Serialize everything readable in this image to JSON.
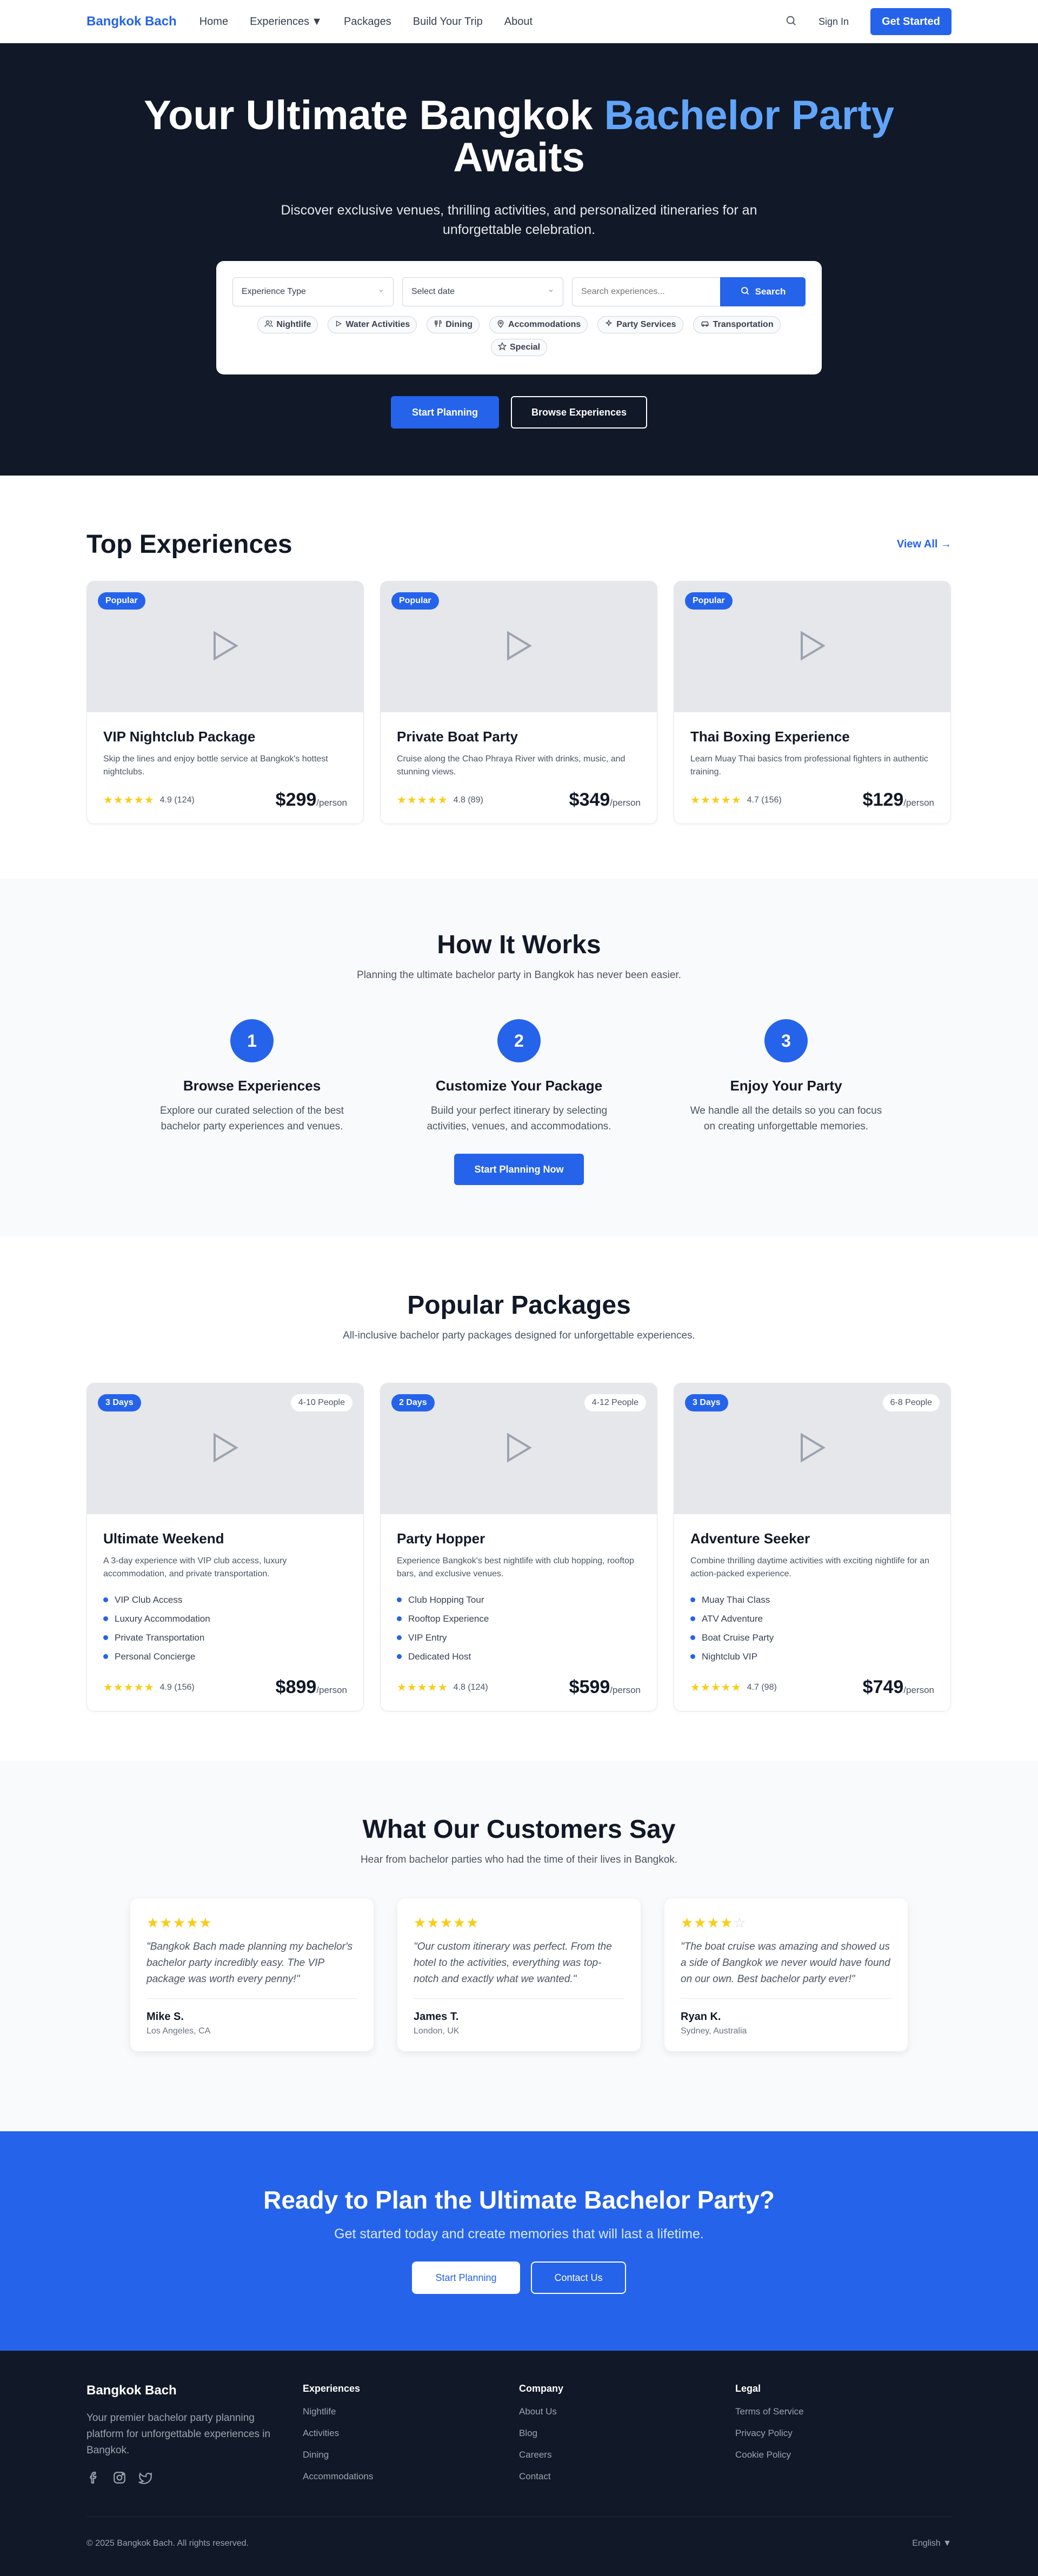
{
  "nav": {
    "brand": "Bangkok Bach",
    "links": [
      "Home",
      "Experiences",
      "Packages",
      "Build Your Trip",
      "About"
    ],
    "signin": "Sign In",
    "cta": "Get Started"
  },
  "hero": {
    "title_main": "Your Ultimate Bangkok ",
    "title_accent": "Bachelor Party",
    "title_end": "Awaits",
    "subtitle": "Discover exclusive venues, thrilling activities, and personalized itineraries for an unforgettable celebration.",
    "select_type": "Experience Type",
    "select_date": "Select date",
    "search_placeholder": "Search experiences...",
    "search_button": "Search",
    "chips": [
      "Nightlife",
      "Water Activities",
      "Dining",
      "Accommodations",
      "Party Services",
      "Transportation",
      "Special"
    ],
    "btn_primary": "Start Planning",
    "btn_secondary": "Browse Experiences"
  },
  "top": {
    "title": "Top Experiences",
    "view_all": "View All →",
    "cards": [
      {
        "badge": "Popular",
        "title": "VIP Nightclub Package",
        "desc": "Skip the lines and enjoy bottle service at Bangkok's hottest nightclubs.",
        "rating": "4.9 (124)",
        "stars": 5,
        "price": "$299",
        "per": "/person"
      },
      {
        "badge": "Popular",
        "title": "Private Boat Party",
        "desc": "Cruise along the Chao Phraya River with drinks, music, and stunning views.",
        "rating": "4.8 (89)",
        "stars": 5,
        "price": "$349",
        "per": "/person"
      },
      {
        "badge": "Popular",
        "title": "Thai Boxing Experience",
        "desc": "Learn Muay Thai basics from professional fighters in authentic training.",
        "rating": "4.7 (156)",
        "stars": 5,
        "price": "$129",
        "per": "/person"
      }
    ]
  },
  "how": {
    "title": "How It Works",
    "subtitle": "Planning the ultimate bachelor party in Bangkok has never been easier.",
    "steps": [
      {
        "num": "1",
        "title": "Browse Experiences",
        "desc": "Explore our curated selection of the best bachelor party experiences and venues."
      },
      {
        "num": "2",
        "title": "Customize Your Package",
        "desc": "Build your perfect itinerary by selecting activities, venues, and accommodations."
      },
      {
        "num": "3",
        "title": "Enjoy Your Party",
        "desc": "We handle all the details so you can focus on creating unforgettable memories."
      }
    ],
    "cta": "Start Planning Now"
  },
  "packages": {
    "title": "Popular Packages",
    "subtitle": "All-inclusive bachelor party packages designed for unforgettable experiences.",
    "cards": [
      {
        "days": "3 Days",
        "people": "4-10 People",
        "title": "Ultimate Weekend",
        "desc": "A 3-day experience with VIP club access, luxury accommodation, and private transportation.",
        "features": [
          "VIP Club Access",
          "Luxury Accommodation",
          "Private Transportation",
          "Personal Concierge"
        ],
        "rating": "4.9 (156)",
        "price": "$899",
        "per": "/person"
      },
      {
        "days": "2 Days",
        "people": "4-12 People",
        "title": "Party Hopper",
        "desc": "Experience Bangkok's best nightlife with club hopping, rooftop bars, and exclusive venues.",
        "features": [
          "Club Hopping Tour",
          "Rooftop Experience",
          "VIP Entry",
          "Dedicated Host"
        ],
        "rating": "4.8 (124)",
        "price": "$599",
        "per": "/person"
      },
      {
        "days": "3 Days",
        "people": "6-8 People",
        "title": "Adventure Seeker",
        "desc": "Combine thrilling daytime activities with exciting nightlife for an action-packed experience.",
        "features": [
          "Muay Thai Class",
          "ATV Adventure",
          "Boat Cruise Party",
          "Nightclub VIP"
        ],
        "rating": "4.7 (98)",
        "price": "$749",
        "per": "/person"
      }
    ]
  },
  "testimonials": {
    "title": "What Our Customers Say",
    "subtitle": "Hear from bachelor parties who had the time of their lives in Bangkok.",
    "items": [
      {
        "stars": 5,
        "quote": "\"Bangkok Bach made planning my bachelor's bachelor party incredibly easy. The VIP package was worth every penny!\"",
        "name": "Mike S.",
        "location": "Los Angeles, CA"
      },
      {
        "stars": 5,
        "quote": "\"Our custom itinerary was perfect. From the hotel to the activities, everything was top-notch and exactly what we wanted.\"",
        "name": "James T.",
        "location": "London, UK"
      },
      {
        "stars": 4,
        "quote": "\"The boat cruise was amazing and showed us a side of Bangkok we never would have found on our own. Best bachelor party ever!\"",
        "name": "Ryan K.",
        "location": "Sydney, Australia"
      }
    ]
  },
  "cta": {
    "title": "Ready to Plan the Ultimate Bachelor Party?",
    "subtitle": "Get started today and create memories that will last a lifetime.",
    "btn_primary": "Start Planning",
    "btn_secondary": "Contact Us"
  },
  "footer": {
    "brand": "Bangkok Bach",
    "tagline": "Your premier bachelor party planning platform for unforgettable experiences in Bangkok.",
    "col1": {
      "title": "Experiences",
      "links": [
        "Nightlife",
        "Activities",
        "Dining",
        "Accommodations"
      ]
    },
    "col2": {
      "title": "Company",
      "links": [
        "About Us",
        "Blog",
        "Careers",
        "Contact"
      ]
    },
    "col3": {
      "title": "Legal",
      "links": [
        "Terms of Service",
        "Privacy Policy",
        "Cookie Policy"
      ]
    },
    "copyright": "© 2025 Bangkok Bach. All rights reserved.",
    "language": "English"
  },
  "colors": {
    "primary": "#2563eb",
    "dark": "#111827",
    "accent": "#60a5fa",
    "star": "#facc15"
  }
}
